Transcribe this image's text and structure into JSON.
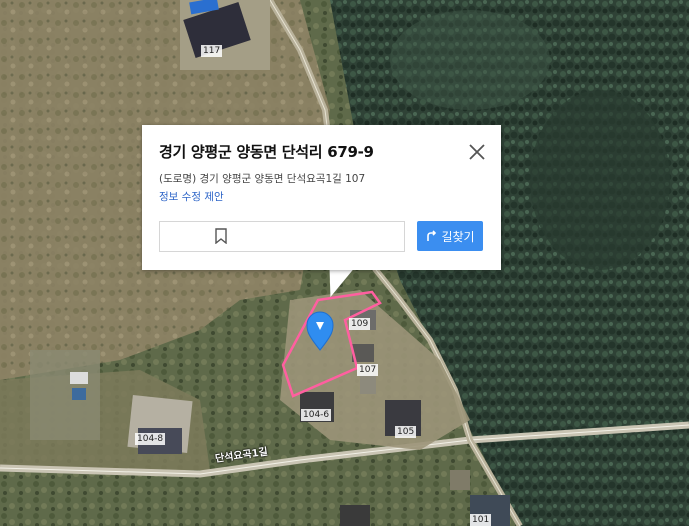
{
  "popup": {
    "title": "경기 양평군 양동면 단석리 679-9",
    "road_address": "(도로명) 경기 양평군 양동면 단석요곡1길 107",
    "edit_link": "정보 수정 제안",
    "route_button": "길찾기",
    "icons": {
      "close": "close-icon",
      "bookmark": "bookmark-icon",
      "share": "share-icon",
      "route": "route-icon"
    }
  },
  "map": {
    "parcel_outline_color": "#ff5fa0",
    "marker_color": "#2f8df0",
    "house_numbers": [
      "117",
      "109",
      "107",
      "104-6",
      "104-8",
      "105",
      "101"
    ],
    "road_names": [
      "단석요곡1길"
    ]
  }
}
